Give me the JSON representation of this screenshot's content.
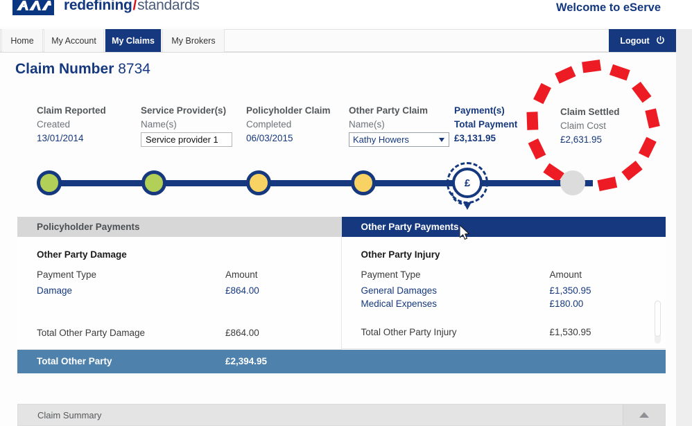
{
  "header": {
    "logo_alt": "AXA",
    "tagline_bold": "redefining",
    "tagline_slash": "/",
    "tagline_light": "standards",
    "welcome": "Welcome to eServe",
    "logout_label": "Logout",
    "logout_icon": "power-icon"
  },
  "nav": {
    "tabs": [
      {
        "label": "Home",
        "active": false
      },
      {
        "label": "My Account",
        "active": false
      },
      {
        "label": "My Claims",
        "active": true
      },
      {
        "label": "My Brokers",
        "active": false
      }
    ]
  },
  "claim": {
    "title_label": "Claim Number",
    "number": "8734"
  },
  "milestones": [
    {
      "title": "Claim Reported",
      "sub": "Created",
      "value": "13/01/2014",
      "kind": "text",
      "accent": false
    },
    {
      "title": "Service Provider(s)",
      "sub": "Name(s)",
      "value": "Service provider 1",
      "kind": "textbox",
      "accent": false
    },
    {
      "title": "Policyholder Claim",
      "sub": "Completed",
      "value": "06/03/2015",
      "kind": "text",
      "accent": false
    },
    {
      "title": "Other Party Claim",
      "sub": "Name(s)",
      "value": "Kathy Howers",
      "kind": "select",
      "accent": false
    },
    {
      "title": "Payment(s)",
      "sub": "Total Payment",
      "value": "£3,131.95",
      "kind": "text",
      "accent": true
    },
    {
      "title": "Claim Settled",
      "sub": "Claim Cost",
      "value": "£2,631.95",
      "kind": "text",
      "accent": false
    }
  ],
  "timeline": {
    "payment_symbol": "£",
    "nodes": [
      "green",
      "green",
      "yellow",
      "yellow",
      "payment",
      "grey"
    ]
  },
  "payments": {
    "left": {
      "tab_label": "Policyholder Payments",
      "section_title": "Other Party Damage",
      "col_type": "Payment Type",
      "col_amount": "Amount",
      "rows": [
        {
          "type": "Damage",
          "amount": "£864.00"
        }
      ],
      "total_label": "Total Other Party Damage",
      "total_amount": "£864.00"
    },
    "right": {
      "tab_label": "Other Party Payments",
      "section_title": "Other Party Injury",
      "col_type": "Payment Type",
      "col_amount": "Amount",
      "rows": [
        {
          "type": "General Damages",
          "amount": "£1,350.95"
        },
        {
          "type": "Medical Expenses",
          "amount": "£180.00"
        }
      ],
      "total_label": "Total Other Party Injury",
      "total_amount": "£1,530.95"
    },
    "grand_total_label": "Total Other Party",
    "grand_total_amount": "£2,394.95"
  },
  "summary": {
    "label": "Claim Summary",
    "toggle_icon": "chevron-up-icon"
  },
  "colors": {
    "brand_blue": "#15387e",
    "brand_red": "#d5111a",
    "annotation_red": "#ed1c24",
    "node_green": "#b2cf57",
    "node_yellow": "#f8d364",
    "node_grey": "#dcdcdc",
    "total_bar": "#4e81ab",
    "tab_grey": "#d7d7d7"
  }
}
